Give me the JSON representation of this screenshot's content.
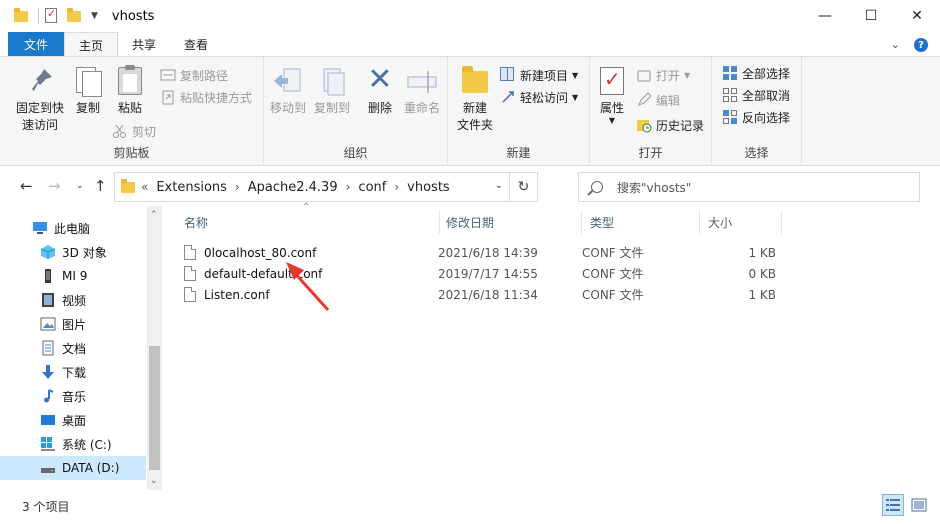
{
  "window": {
    "title": "vhosts"
  },
  "controls": {
    "minimize": "—",
    "maximize": "☐",
    "close": "✕"
  },
  "tabs": [
    {
      "label": "文件"
    },
    {
      "label": "主页"
    },
    {
      "label": "共享"
    },
    {
      "label": "查看"
    }
  ],
  "ribbon": {
    "clipboard": {
      "group_label": "剪贴板",
      "pin": "固定到快\n速访问",
      "pin_line1": "固定到快",
      "pin_line2": "速访问",
      "copy": "复制",
      "paste": "粘贴",
      "copy_path": "复制路径",
      "paste_shortcut": "粘贴快捷方式",
      "cut": "剪切"
    },
    "organize": {
      "group_label": "组织",
      "move_to": "移动到",
      "copy_to": "复制到",
      "delete": "删除",
      "rename": "重命名"
    },
    "new": {
      "group_label": "新建",
      "new_folder_line1": "新建",
      "new_folder_line2": "文件夹",
      "new_item": "新建项目",
      "easy_access": "轻松访问"
    },
    "open": {
      "group_label": "打开",
      "properties": "属性",
      "open": "打开",
      "edit": "编辑",
      "history": "历史记录"
    },
    "select": {
      "group_label": "选择",
      "select_all": "全部选择",
      "select_none": "全部取消",
      "invert": "反向选择"
    }
  },
  "address": {
    "crumbs": [
      "Extensions",
      "Apache2.4.39",
      "conf",
      "vhosts"
    ],
    "prefix": "«"
  },
  "search": {
    "placeholder": "搜索\"vhosts\""
  },
  "navpane": {
    "items": [
      {
        "label": "此电脑"
      },
      {
        "label": "3D 对象"
      },
      {
        "label": "MI 9"
      },
      {
        "label": "视频"
      },
      {
        "label": "图片"
      },
      {
        "label": "文档"
      },
      {
        "label": "下载"
      },
      {
        "label": "音乐"
      },
      {
        "label": "桌面"
      },
      {
        "label": "系统 (C:)"
      },
      {
        "label": "DATA (D:)"
      }
    ]
  },
  "columns": {
    "name": "名称",
    "date": "修改日期",
    "type": "类型",
    "size": "大小"
  },
  "files": [
    {
      "name": "0localhost_80.conf",
      "date": "2021/6/18 14:39",
      "type": "CONF 文件",
      "size": "1 KB"
    },
    {
      "name": "default-default.conf",
      "date": "2019/7/17 14:55",
      "type": "CONF 文件",
      "size": "0 KB"
    },
    {
      "name": "Listen.conf",
      "date": "2021/6/18 11:34",
      "type": "CONF 文件",
      "size": "1 KB"
    }
  ],
  "status": {
    "count": "3 个项目"
  },
  "colors": {
    "accent": "#1979ca",
    "selection": "#cce8ff",
    "arrow": "#e8372c"
  }
}
